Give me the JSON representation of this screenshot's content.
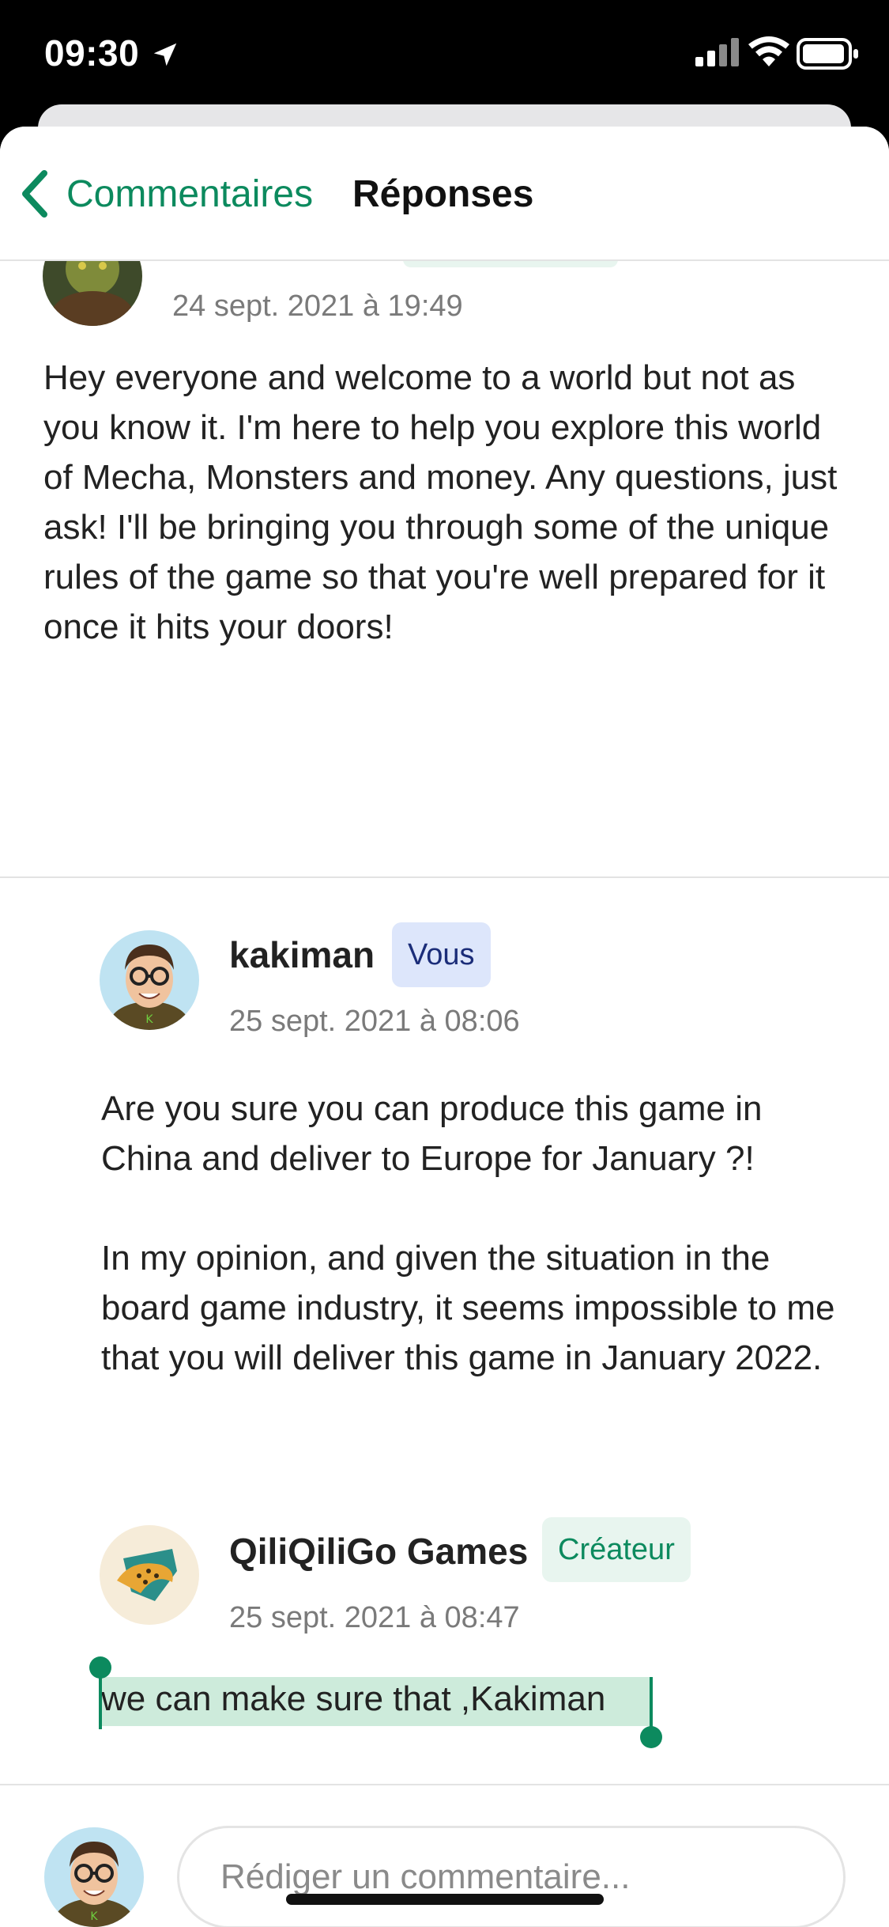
{
  "status_bar": {
    "time": "09:30",
    "icons": [
      "location-arrow-icon",
      "signal-icon",
      "wifi-icon",
      "battery-icon"
    ]
  },
  "nav": {
    "back_label": "Commentaires",
    "title": "Réponses"
  },
  "top_comment": {
    "date": "24 sept. 2021 à 19:49",
    "body": "Hey everyone and welcome to a world but not as you know it. I'm here to help you explore this world of Mecha, Monsters and money. Any questions, just ask! I'll be bringing you through some of the unique rules of the game so that you're well prepared for it once it hits your doors!"
  },
  "replies": [
    {
      "author": "kakiman",
      "badge": "Vous",
      "date": "25 sept. 2021 à 08:06",
      "paragraphs": [
        "Are you sure you can produce this game in China and deliver to Europe for January ?!",
        "In my opinion, and given the situation in the board game industry, it seems impossible to me that you will deliver this game in January 2022."
      ]
    },
    {
      "author": "QiliQiliGo Games",
      "badge": "Créateur",
      "date": "25 sept. 2021 à 08:47",
      "body": "we can make sure that ,Kakiman"
    }
  ],
  "composer": {
    "placeholder": "Rédiger un commentaire..."
  },
  "colors": {
    "accent": "#0c8a5e",
    "badge_you_bg": "#dde6fb",
    "badge_creator_bg": "#e8f5ef",
    "selection": "#cdebdb"
  }
}
